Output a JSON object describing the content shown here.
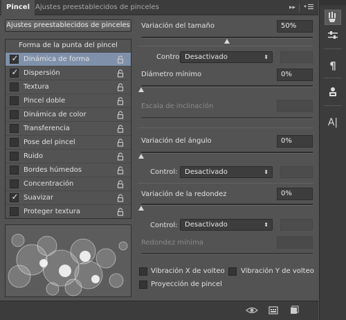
{
  "tabs": [
    {
      "label": "Pincel",
      "active": true
    },
    {
      "label": "Ajustes preestablecidos de pinceles",
      "active": false
    }
  ],
  "tab_icons": {
    "expand": "double-chevron-icon",
    "menu": "panel-menu-icon"
  },
  "presets_button": "Ajustes preestablecidos de pinceles",
  "list": {
    "header": "Forma de la punta del pincel",
    "items": [
      {
        "label": "Dinámica de forma",
        "checked": true,
        "selected": true
      },
      {
        "label": "Dispersión",
        "checked": true,
        "selected": false
      },
      {
        "label": "Textura",
        "checked": false,
        "selected": false
      },
      {
        "label": "Pincel doble",
        "checked": false,
        "selected": false
      },
      {
        "label": "Dinámica de color",
        "checked": false,
        "selected": false
      },
      {
        "label": "Transferencia",
        "checked": false,
        "selected": false
      },
      {
        "label": "Pose del pincel",
        "checked": false,
        "selected": false
      },
      {
        "label": "Ruido",
        "checked": false,
        "selected": false
      },
      {
        "label": "Bordes húmedos",
        "checked": false,
        "selected": false
      },
      {
        "label": "Concentración",
        "checked": false,
        "selected": false
      },
      {
        "label": "Suavizar",
        "checked": true,
        "selected": false
      },
      {
        "label": "Proteger textura",
        "checked": false,
        "selected": false
      }
    ]
  },
  "settings": {
    "size_jitter": {
      "label": "Variación del tamaño",
      "value": "50%",
      "level": 0.5
    },
    "size_control": {
      "label": "Control:",
      "value": "Desactivado"
    },
    "min_diameter": {
      "label": "Diámetro mínimo",
      "value": "0%",
      "level": 0
    },
    "tilt_scale": {
      "label": "Escala de inclinación"
    },
    "angle_jitter": {
      "label": "Variación del ángulo",
      "value": "0%",
      "level": 0
    },
    "angle_control": {
      "label": "Control:",
      "value": "Desactivado"
    },
    "roundness_jitter": {
      "label": "Variación de la redondez",
      "value": "0%",
      "level": 0
    },
    "roundness_control": {
      "label": "Control:",
      "value": "Desactivado"
    },
    "min_roundness": {
      "label": "Redondez mínima"
    },
    "flip_x": {
      "label": "Vibración X de volteo",
      "checked": false
    },
    "flip_y": {
      "label": "Vibración Y de volteo",
      "checked": false
    },
    "brush_projection": {
      "label": "Proyección de pincel",
      "checked": false
    }
  },
  "right_strip_icons": [
    "brush-panel-icon",
    "brush-sliders-icon",
    "paragraph-icon",
    "clone-source-icon",
    "character-icon"
  ],
  "bottom_icons": [
    "toggle-live-tip-icon",
    "grid-icon",
    "new-preset-icon"
  ],
  "colors": {
    "panel": "#535353",
    "chrome": "#3c3c3c",
    "selection": "#7f90aa"
  }
}
